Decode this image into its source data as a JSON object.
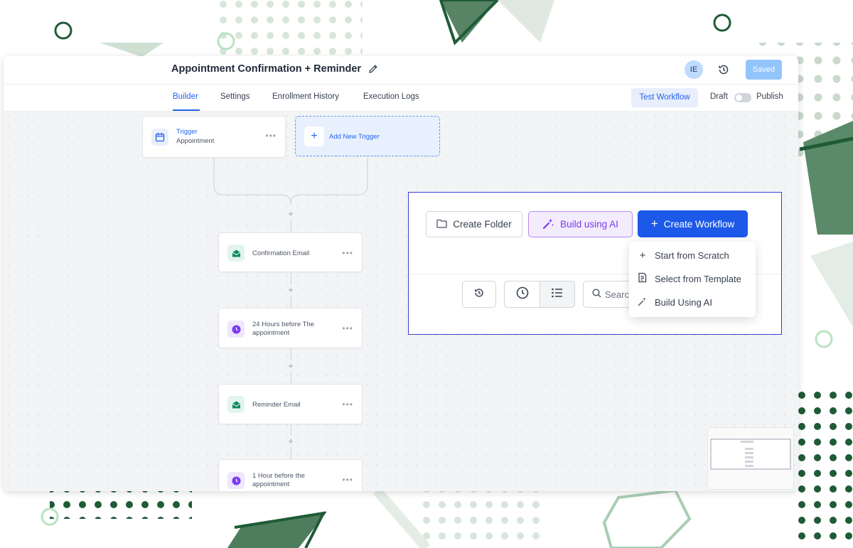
{
  "workflow": {
    "title": "Appointment Confirmation + Reminder",
    "avatar_initials": "IE",
    "saved_label": "Saved"
  },
  "tabs": [
    {
      "label": "Builder",
      "active": true
    },
    {
      "label": "Settings",
      "active": false
    },
    {
      "label": "Enrollment History",
      "active": false
    },
    {
      "label": "Execution Logs",
      "active": false
    }
  ],
  "toolbar": {
    "test_workflow_label": "Test Workflow",
    "draft_label": "Draft",
    "publish_label": "Publish",
    "publish_toggle_on": false
  },
  "trigger": {
    "title": "Trigger",
    "subtitle": "Appointment",
    "add_trigger_label": "Add New Trigger"
  },
  "steps": [
    {
      "label": "Confirmation Email",
      "icon": "email-icon"
    },
    {
      "label": "24 Hours before The appointment",
      "icon": "clock-icon"
    },
    {
      "label": "Reminder Email",
      "icon": "email-icon"
    },
    {
      "label": "1 Hour before the appointment",
      "icon": "clock-icon"
    }
  ],
  "panel": {
    "create_folder_label": "Create Folder",
    "build_ai_label": "Build using AI",
    "create_workflow_label": "Create Workflow",
    "search_placeholder": "Search",
    "dropdown": [
      {
        "label": "Start from Scratch",
        "icon": "plus-icon"
      },
      {
        "label": "Select from Template",
        "icon": "template-icon"
      },
      {
        "label": "Build Using AI",
        "icon": "sparkle-icon"
      }
    ]
  },
  "colors": {
    "accent_blue": "#1d59e8",
    "ai_purple": "#7c3aed",
    "highlight_border": "#3b3fd8",
    "email_icon_green": "#0f8a5f",
    "clock_icon_purple": "#7e3af2",
    "decor_green": "#2f6b45"
  }
}
